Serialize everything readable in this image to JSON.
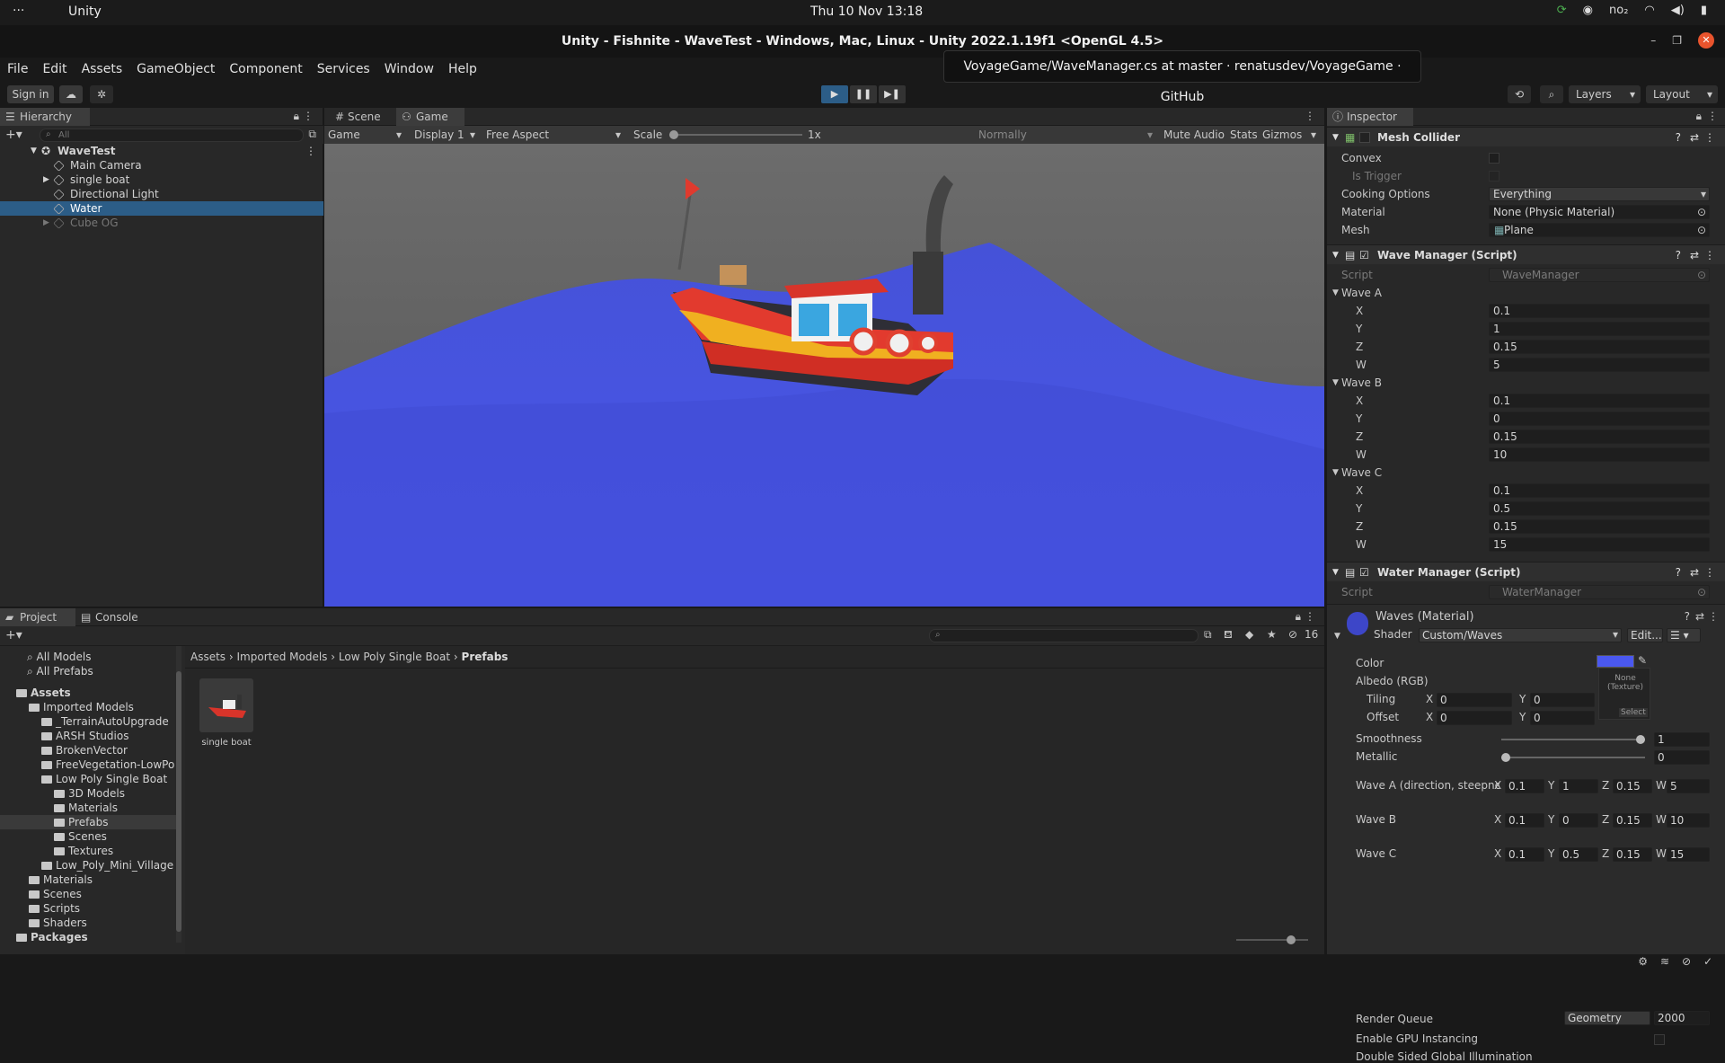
{
  "os": {
    "menu_dots": "···",
    "app_name": "Unity",
    "clock": "Thu 10 Nov  13:18",
    "tray_text": "no₂"
  },
  "window": {
    "title": "Unity - Fishnite - WaveTest - Windows, Mac, Linux - Unity 2022.1.19f1 <OpenGL 4.5>"
  },
  "tooltip": "VoyageGame/WaveManager.cs at master · renatusdev/VoyageGame · GitHub",
  "menu": [
    "File",
    "Edit",
    "Assets",
    "GameObject",
    "Component",
    "Services",
    "Window",
    "Help"
  ],
  "toolbar": {
    "sign_in": "Sign in",
    "layers": "Layers",
    "layout": "Layout"
  },
  "hierarchy": {
    "tab": "Hierarchy",
    "search_placeholder": "All",
    "items": [
      {
        "label": "WaveTest",
        "depth": 0,
        "selected": false,
        "dim": false
      },
      {
        "label": "Main Camera",
        "depth": 1,
        "selected": false,
        "dim": false
      },
      {
        "label": "single boat",
        "depth": 1,
        "selected": false,
        "dim": false
      },
      {
        "label": "Directional Light",
        "depth": 1,
        "selected": false,
        "dim": false
      },
      {
        "label": "Water",
        "depth": 1,
        "selected": true,
        "dim": false
      },
      {
        "label": "Cube OG",
        "depth": 1,
        "selected": false,
        "dim": true
      }
    ]
  },
  "game": {
    "tab_scene": "Scene",
    "tab_game": "Game",
    "mode": "Game",
    "display": "Display 1",
    "aspect": "Free Aspect",
    "scale_label": "Scale",
    "scale_value": "1x",
    "vsync": "Normally",
    "mute": "Mute Audio",
    "stats": "Stats",
    "gizmos": "Gizmos"
  },
  "inspector": {
    "tab": "Inspector",
    "mesh_collider": {
      "title": "Mesh Collider",
      "convex": "Convex",
      "is_trigger": "Is Trigger",
      "cooking_label": "Cooking Options",
      "cooking_value": "Everything",
      "material_label": "Material",
      "material_value": "None (Physic Material)",
      "mesh_label": "Mesh",
      "mesh_value": "Plane"
    },
    "wave_manager": {
      "title": "Wave Manager (Script)",
      "script_label": "Script",
      "script_value": "WaveManager",
      "waves": [
        {
          "name": "Wave A",
          "x": "0.1",
          "y": "1",
          "z": "0.15",
          "w": "5"
        },
        {
          "name": "Wave B",
          "x": "0.1",
          "y": "0",
          "z": "0.15",
          "w": "10"
        },
        {
          "name": "Wave C",
          "x": "0.1",
          "y": "0.5",
          "z": "0.15",
          "w": "15"
        }
      ]
    },
    "water_manager": {
      "title": "Water Manager (Script)",
      "script_label": "Script",
      "script_value": "WaterManager"
    },
    "material": {
      "title": "Waves (Material)",
      "shader_label": "Shader",
      "shader_value": "Custom/Waves",
      "edit": "Edit...",
      "color_label": "Color",
      "color_value": "#4a58f0",
      "albedo_label": "Albedo (RGB)",
      "texture_none": "None (Texture)",
      "select": "Select",
      "tiling_label": "Tiling",
      "tiling_x": "0",
      "tiling_y": "0",
      "offset_label": "Offset",
      "offset_x": "0",
      "offset_y": "0",
      "smoothness_label": "Smoothness",
      "smoothness_value": "1",
      "metallic_label": "Metallic",
      "metallic_value": "0",
      "wave_a_label": "Wave A (direction, steepness",
      "wave_b_label": "Wave B",
      "wave_c_label": "Wave C",
      "wa": {
        "x": "0.1",
        "y": "1",
        "z": "0.15",
        "w": "5"
      },
      "wb": {
        "x": "0.1",
        "y": "0",
        "z": "0.15",
        "w": "10"
      },
      "wc": {
        "x": "0.1",
        "y": "0.5",
        "z": "0.15",
        "w": "15"
      },
      "render_queue_label": "Render Queue",
      "render_queue_mode": "Geometry",
      "render_queue_value": "2000",
      "gpu_inst": "Enable GPU Instancing",
      "double_sided": "Double Sided Global Illumination"
    }
  },
  "project": {
    "tab_project": "Project",
    "tab_console": "Console",
    "hidden_count": "16",
    "favorites": [
      "All Models",
      "All Prefabs"
    ],
    "tree": [
      {
        "label": "Assets",
        "depth": 0,
        "bold": true
      },
      {
        "label": "Imported Models",
        "depth": 1
      },
      {
        "label": "_TerrainAutoUpgrade",
        "depth": 2
      },
      {
        "label": "ARSH Studios",
        "depth": 2
      },
      {
        "label": "BrokenVector",
        "depth": 2
      },
      {
        "label": "FreeVegetation-LowPo",
        "depth": 2
      },
      {
        "label": "Low Poly Single Boat",
        "depth": 2
      },
      {
        "label": "3D Models",
        "depth": 3
      },
      {
        "label": "Materials",
        "depth": 3
      },
      {
        "label": "Prefabs",
        "depth": 3,
        "selected": true
      },
      {
        "label": "Scenes",
        "depth": 3
      },
      {
        "label": "Textures",
        "depth": 3
      },
      {
        "label": "Low_Poly_Mini_Village",
        "depth": 2
      },
      {
        "label": "Materials",
        "depth": 1
      },
      {
        "label": "Scenes",
        "depth": 1
      },
      {
        "label": "Scripts",
        "depth": 1
      },
      {
        "label": "Shaders",
        "depth": 1
      },
      {
        "label": "Packages",
        "depth": 0,
        "bold": true
      }
    ],
    "breadcrumb": [
      "Assets",
      "Imported Models",
      "Low Poly Single Boat",
      "Prefabs"
    ],
    "asset": "single boat"
  },
  "colors": {
    "selection": "#2c5d87",
    "water": "#4a58e8",
    "play_active": "#2c5d87"
  }
}
